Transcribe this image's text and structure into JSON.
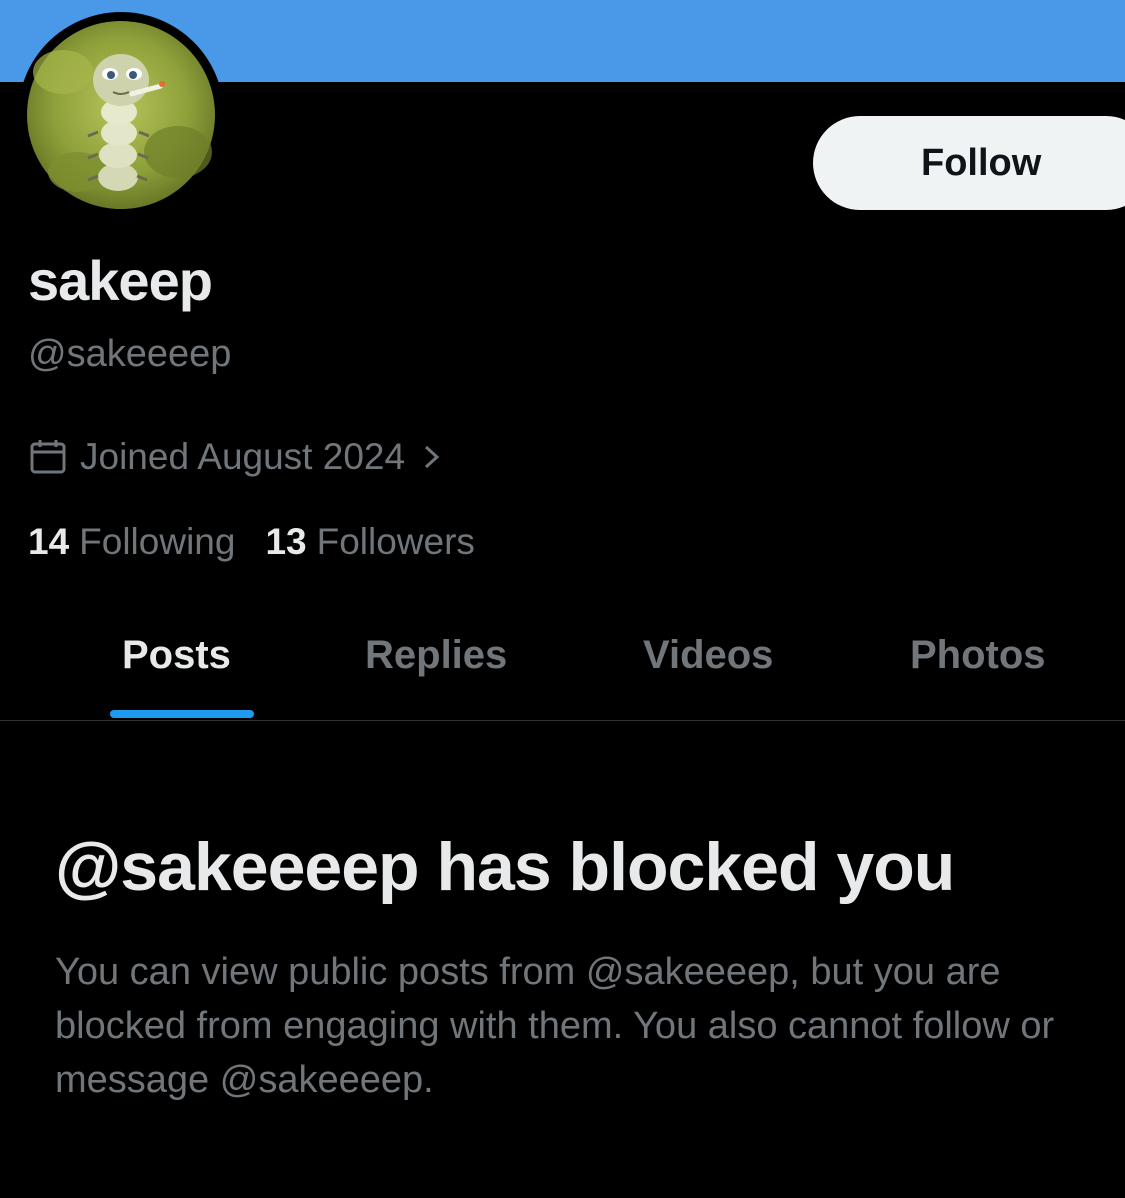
{
  "profile": {
    "display_name": "sakeep",
    "handle": "@sakeeeep",
    "joined": "Joined August 2024",
    "following_count": "14",
    "following_label": "Following",
    "followers_count": "13",
    "followers_label": "Followers",
    "follow_button": "Follow"
  },
  "tabs": [
    {
      "label": "Posts",
      "active": true
    },
    {
      "label": "Replies",
      "active": false
    },
    {
      "label": "Videos",
      "active": false
    },
    {
      "label": "Photos",
      "active": false
    }
  ],
  "blocked": {
    "title": "@sakeeeep has blocked you",
    "description": "You can view public posts from @sakeeeep, but you are blocked from engaging with them. You also cannot follow or message @sakeeeep."
  },
  "icons": {
    "calendar": "calendar-icon",
    "chevron": "chevron-right-icon"
  },
  "colors": {
    "banner": "#4a99e9",
    "accent": "#1d9bf0",
    "background": "#000000",
    "secondary_text": "#71767b",
    "button_bg": "#eff3f4"
  }
}
